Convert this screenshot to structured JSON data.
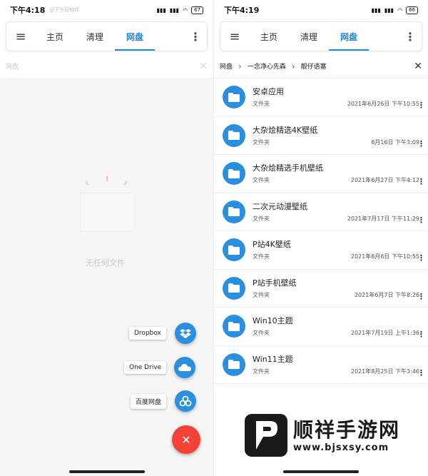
{
  "left": {
    "status": {
      "time": "下午4:18",
      "sub": "@下午好软件",
      "battery": "67"
    },
    "tabs": [
      "主页",
      "清理",
      "网盘"
    ],
    "crumb": "网盘",
    "empty_text": "无任何文件",
    "fab_options": [
      {
        "label": "Dropbox",
        "icon": "dropbox-icon"
      },
      {
        "label": "One Drive",
        "icon": "onedrive-icon"
      },
      {
        "label": "百度网盘",
        "icon": "baidu-pan-icon"
      }
    ],
    "main_fab_icon": "close-icon",
    "colors": {
      "accent": "#1e88e5",
      "fab": "#f44336",
      "mini_fab": "#2b8fe0"
    }
  },
  "right": {
    "status": {
      "time": "下午4:19",
      "battery": "66"
    },
    "tabs": [
      "主页",
      "清理",
      "网盘"
    ],
    "breadcrumb": [
      "网盘",
      "一念净心先森",
      "靓仔语塞"
    ],
    "folders": [
      {
        "name": "安卓应用",
        "type": "文件夹",
        "date": "2021年6月26日 下午10:55"
      },
      {
        "name": "大杂烩精选4K壁纸",
        "type": "文件夹",
        "date": "6月16日 下午3:09"
      },
      {
        "name": "大杂烩精选手机壁纸",
        "type": "文件夹",
        "date": "2021年6月27日 下午4:12"
      },
      {
        "name": "二次元动漫壁纸",
        "type": "文件夹",
        "date": "2021年7月17日 下午11:29"
      },
      {
        "name": "P站4K壁纸",
        "type": "文件夹",
        "date": "2021年6月6日 下午10:55"
      },
      {
        "name": "P站手机壁纸",
        "type": "文件夹",
        "date": "2021年6月7日 下午8:26"
      },
      {
        "name": "Win10主题",
        "type": "文件夹",
        "date": "2021年7月19日 上午1:36"
      },
      {
        "name": "Win11主题",
        "type": "文件夹",
        "date": "2021年8月25日 下午3:46"
      }
    ]
  },
  "watermark": {
    "title": "顺祥手游网",
    "url": "www.bjsxsy.com"
  }
}
